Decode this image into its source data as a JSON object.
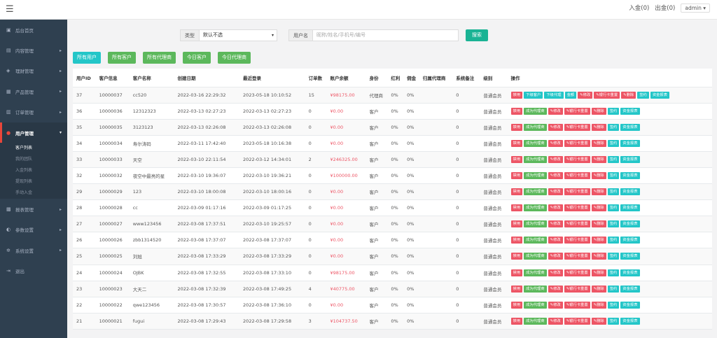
{
  "topbar": {
    "menu_icon": "hamburger-icon",
    "in_gold": "入金(0)",
    "out_gold": "出金(0)",
    "user": "admin"
  },
  "sidebar": {
    "items": [
      {
        "label": "后台首页",
        "icon": "dashboard-icon",
        "arrow": ""
      },
      {
        "label": "内容管理",
        "icon": "document-icon",
        "arrow": "▸"
      },
      {
        "label": "理财管理",
        "icon": "finance-icon",
        "arrow": "▸"
      },
      {
        "label": "产品管理",
        "icon": "product-icon",
        "arrow": "▸"
      },
      {
        "label": "订单管理",
        "icon": "order-icon",
        "arrow": "▸"
      },
      {
        "label": "用户管理",
        "icon": "user-icon",
        "arrow": "▾"
      },
      {
        "label": "报表管理",
        "icon": "report-icon",
        "arrow": "▸"
      },
      {
        "label": "参数设置",
        "icon": "params-icon",
        "arrow": "▸"
      },
      {
        "label": "系统设置",
        "icon": "settings-icon",
        "arrow": "▸"
      },
      {
        "label": "退出",
        "icon": "logout-icon",
        "arrow": ""
      }
    ],
    "sub_items": [
      "客户列表",
      "我的团队",
      "入金列表",
      "提现列表",
      "手动入金"
    ]
  },
  "filter": {
    "type_label": "类型",
    "type_value": "默认不选",
    "user_label": "用户名",
    "user_placeholder": "昵称/姓名/手机号/编号",
    "search_label": "搜索"
  },
  "quick_buttons": [
    "所有用户",
    "所有客户",
    "所有代理商",
    "今日客户",
    "今日代理商"
  ],
  "table": {
    "headers": [
      "用户ID",
      "客户信息",
      "客户名称",
      "创建日期",
      "最近登录",
      "订单数",
      "账户余额",
      "身份",
      "红利",
      "佣金",
      "归属代理商",
      "系统备注",
      "级别",
      "操作"
    ],
    "rows": [
      {
        "id": "37",
        "info": "10000037",
        "name": "cc520",
        "created": "2022-03-16 22:29:32",
        "login": "2023-05-18 10:10:52",
        "orders": "15",
        "balance": "¥98175.00",
        "role": "代理商",
        "bonus": "0%",
        "commission": "0%",
        "agent": "",
        "note": "0",
        "level": "普通会员",
        "ops": "agent"
      },
      {
        "id": "36",
        "info": "10000036",
        "name": "12312323",
        "created": "2022-03-13 02:27:23",
        "login": "2022-03-13 02:27:23",
        "orders": "0",
        "balance": "¥0.00",
        "role": "客户",
        "bonus": "0%",
        "commission": "0%",
        "agent": "",
        "note": "0",
        "level": "普通会员",
        "ops": "client"
      },
      {
        "id": "35",
        "info": "10000035",
        "name": "3123123",
        "created": "2022-03-13 02:26:08",
        "login": "2022-03-13 02:26:08",
        "orders": "0",
        "balance": "¥0.00",
        "role": "客户",
        "bonus": "0%",
        "commission": "0%",
        "agent": "",
        "note": "0",
        "level": "普通会员",
        "ops": "client"
      },
      {
        "id": "34",
        "info": "10000034",
        "name": "寿尔涛码",
        "created": "2022-03-11 17:42:40",
        "login": "2023-05-18 10:16:38",
        "orders": "0",
        "balance": "¥0.00",
        "role": "客户",
        "bonus": "0%",
        "commission": "0%",
        "agent": "",
        "note": "0",
        "level": "普通会员",
        "ops": "client"
      },
      {
        "id": "33",
        "info": "10000033",
        "name": "天空",
        "created": "2022-03-10 22:11:54",
        "login": "2022-03-12 14:34:01",
        "orders": "2",
        "balance": "¥246325.00",
        "role": "客户",
        "bonus": "0%",
        "commission": "0%",
        "agent": "",
        "note": "0",
        "level": "普通会员",
        "ops": "client"
      },
      {
        "id": "32",
        "info": "10000032",
        "name": "夜空中最亮的星",
        "created": "2022-03-10 19:36:07",
        "login": "2022-03-10 19:36:21",
        "orders": "0",
        "balance": "¥100000.00",
        "role": "客户",
        "bonus": "0%",
        "commission": "0%",
        "agent": "",
        "note": "0",
        "level": "普通会员",
        "ops": "client"
      },
      {
        "id": "29",
        "info": "10000029",
        "name": "123",
        "created": "2022-03-10 18:00:08",
        "login": "2022-03-10 18:00:16",
        "orders": "0",
        "balance": "¥0.00",
        "role": "客户",
        "bonus": "0%",
        "commission": "0%",
        "agent": "",
        "note": "0",
        "level": "普通会员",
        "ops": "client"
      },
      {
        "id": "28",
        "info": "10000028",
        "name": "cc",
        "created": "2022-03-09 01:17:16",
        "login": "2022-03-09 01:17:25",
        "orders": "0",
        "balance": "¥0.00",
        "role": "客户",
        "bonus": "0%",
        "commission": "0%",
        "agent": "",
        "note": "0",
        "level": "普通会员",
        "ops": "client"
      },
      {
        "id": "27",
        "info": "10000027",
        "name": "www123456",
        "created": "2022-03-08 17:37:51",
        "login": "2022-03-10 19:25:57",
        "orders": "0",
        "balance": "¥0.00",
        "role": "客户",
        "bonus": "0%",
        "commission": "0%",
        "agent": "",
        "note": "0",
        "level": "普通会员",
        "ops": "client"
      },
      {
        "id": "26",
        "info": "10000026",
        "name": "zbb1314520",
        "created": "2022-03-08 17:37:07",
        "login": "2022-03-08 17:37:07",
        "orders": "0",
        "balance": "¥0.00",
        "role": "客户",
        "bonus": "0%",
        "commission": "0%",
        "agent": "",
        "note": "0",
        "level": "普通会员",
        "ops": "client"
      },
      {
        "id": "25",
        "info": "10000025",
        "name": "刘旭",
        "created": "2022-03-08 17:33:29",
        "login": "2022-03-08 17:33:29",
        "orders": "0",
        "balance": "¥0.00",
        "role": "客户",
        "bonus": "0%",
        "commission": "0%",
        "agent": "",
        "note": "0",
        "level": "普通会员",
        "ops": "client"
      },
      {
        "id": "24",
        "info": "10000024",
        "name": "OJBK",
        "created": "2022-03-08 17:32:55",
        "login": "2022-03-08 17:33:10",
        "orders": "0",
        "balance": "¥98175.00",
        "role": "客户",
        "bonus": "0%",
        "commission": "0%",
        "agent": "",
        "note": "0",
        "level": "普通会员",
        "ops": "client"
      },
      {
        "id": "23",
        "info": "10000023",
        "name": "大天二",
        "created": "2022-03-08 17:32:39",
        "login": "2022-03-08 17:49:25",
        "orders": "4",
        "balance": "¥40775.00",
        "role": "客户",
        "bonus": "0%",
        "commission": "0%",
        "agent": "",
        "note": "0",
        "level": "普通会员",
        "ops": "client"
      },
      {
        "id": "22",
        "info": "10000022",
        "name": "qwe123456",
        "created": "2022-03-08 17:30:57",
        "login": "2022-03-08 17:36:10",
        "orders": "0",
        "balance": "¥0.00",
        "role": "客户",
        "bonus": "0%",
        "commission": "0%",
        "agent": "",
        "note": "0",
        "level": "普通会员",
        "ops": "client"
      },
      {
        "id": "21",
        "info": "10000021",
        "name": "fugui",
        "created": "2022-03-08 17:29:43",
        "login": "2022-03-08 17:29:58",
        "orders": "3",
        "balance": "¥104737.50",
        "role": "客户",
        "bonus": "0%",
        "commission": "0%",
        "agent": "",
        "note": "0",
        "level": "普通会员",
        "ops": "client"
      }
    ],
    "ops": {
      "agent": [
        {
          "label": "禁用",
          "color": "r"
        },
        {
          "label": "下级客户",
          "color": "t"
        },
        {
          "label": "下级代理",
          "color": "t"
        },
        {
          "label": "金额",
          "color": "t"
        },
        {
          "label": "✎修改",
          "color": "r"
        },
        {
          "label": "✎银行卡重置",
          "color": "r"
        },
        {
          "label": "✎删除",
          "color": "r"
        },
        {
          "label": "签约",
          "color": "t"
        },
        {
          "label": "资金报表",
          "color": "t"
        }
      ],
      "client": [
        {
          "label": "禁用",
          "color": "r"
        },
        {
          "label": "成为代理商",
          "color": "g"
        },
        {
          "label": "✎修改",
          "color": "r"
        },
        {
          "label": "✎银行卡重置",
          "color": "r"
        },
        {
          "label": "✎删除",
          "color": "r"
        },
        {
          "label": "签约",
          "color": "t"
        },
        {
          "label": "资金报表",
          "color": "t"
        }
      ]
    }
  }
}
